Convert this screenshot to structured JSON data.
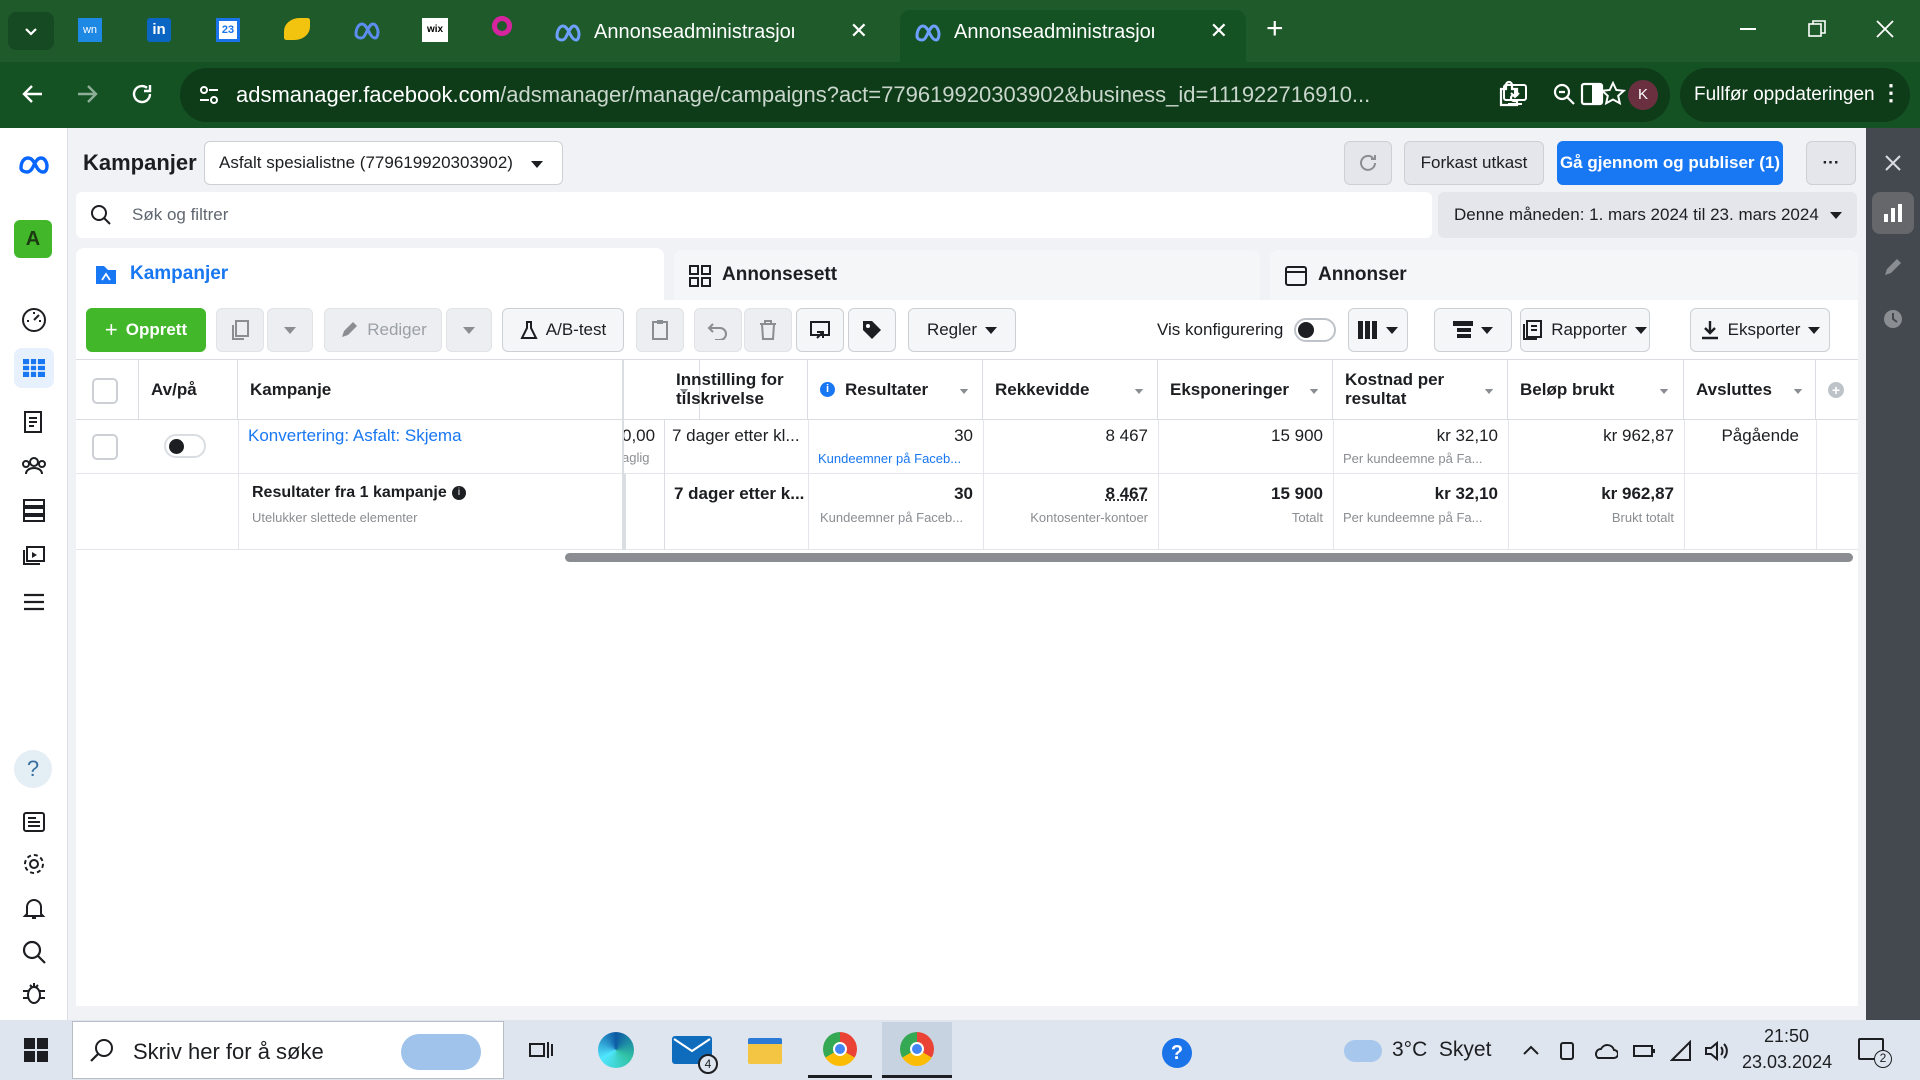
{
  "browser": {
    "tabs": [
      {
        "title": "Annonseadministrasjon - Admin",
        "close": "✕",
        "active": false
      },
      {
        "title": "Annonseadministrasjon - Admin",
        "close": "✕",
        "active": true
      }
    ],
    "new_tab": "+",
    "url_host": "adsmanager.facebook.com",
    "url_path": "/adsmanager/manage/campaigns?act=779619920303902&business_id=111922716910...",
    "profile_initial": "K",
    "update_label": "Fullfør oppdateringen",
    "pinned_icons": [
      "wn",
      "in",
      "23",
      "wix"
    ]
  },
  "leftnav": {
    "account_initial": "A",
    "help": "?"
  },
  "header": {
    "title": "Kampanjer",
    "account_select": "Asfalt spesialistne (779619920303902)",
    "discard_label": "Forkast utkast",
    "publish_label": "Gå gjennom og publiser (1)",
    "more_label": "···"
  },
  "search": {
    "placeholder": "Søk og filtrer",
    "date_range": "Denne måneden: 1. mars 2024 til 23. mars 2024"
  },
  "level_tabs": [
    {
      "label": "Kampanjer",
      "active": true
    },
    {
      "label": "Annonsesett",
      "active": false
    },
    {
      "label": "Annonser",
      "active": false
    }
  ],
  "toolbar": {
    "create": "Opprett",
    "edit": "Rediger",
    "ab_test": "A/B-test",
    "rules": "Regler",
    "show_config": "Vis konfigurering",
    "reports": "Rapporter",
    "export": "Eksporter"
  },
  "table": {
    "columns": {
      "onoff": "Av/på",
      "campaign": "Kampanje",
      "attribution": "Innstilling for tilskrivelse",
      "results": "Resultater",
      "reach": "Rekkevidde",
      "impressions": "Eksponeringer",
      "cost_per_result": "Kostnad per resultat",
      "amount_spent": "Beløp brukt",
      "ends": "Avsluttes"
    },
    "row": {
      "campaign": "Konvertering: Asfalt: Skjema",
      "hidden_value": "0,00",
      "hidden_sub": "aglig",
      "attribution": "7 dager etter kl...",
      "results": "30",
      "results_sub": "Kundeemner på Faceb...",
      "reach": "8 467",
      "impressions": "15 900",
      "cost_per_result": "kr 32,10",
      "cost_sub": "Per kundeemne på Fa...",
      "amount_spent": "kr 962,87",
      "ends": "Pågående"
    },
    "summary": {
      "title": "Resultater fra 1 kampanje",
      "subtitle": "Utelukker slettede elementer",
      "attribution": "7 dager etter k...",
      "results": "30",
      "results_sub": "Kundeemner på Faceb...",
      "reach": "8 467",
      "reach_sub": "Kontosenter-kontoer",
      "impressions": "15 900",
      "impressions_sub": "Totalt",
      "cost_per_result": "kr 32,10",
      "cost_sub": "Per kundeemne på Fa...",
      "amount_spent": "kr 962,87",
      "amount_sub": "Brukt totalt"
    }
  },
  "taskbar": {
    "search_placeholder": "Skriv her for å søke",
    "mail_badge": "4",
    "weather": "3°C  Skyet",
    "time": "21:50",
    "date": "23.03.2024",
    "notif_count": "2"
  },
  "colors": {
    "chrome_green": "#1f5a2b",
    "fb_blue": "#1877f2",
    "create_green": "#42b72a"
  }
}
